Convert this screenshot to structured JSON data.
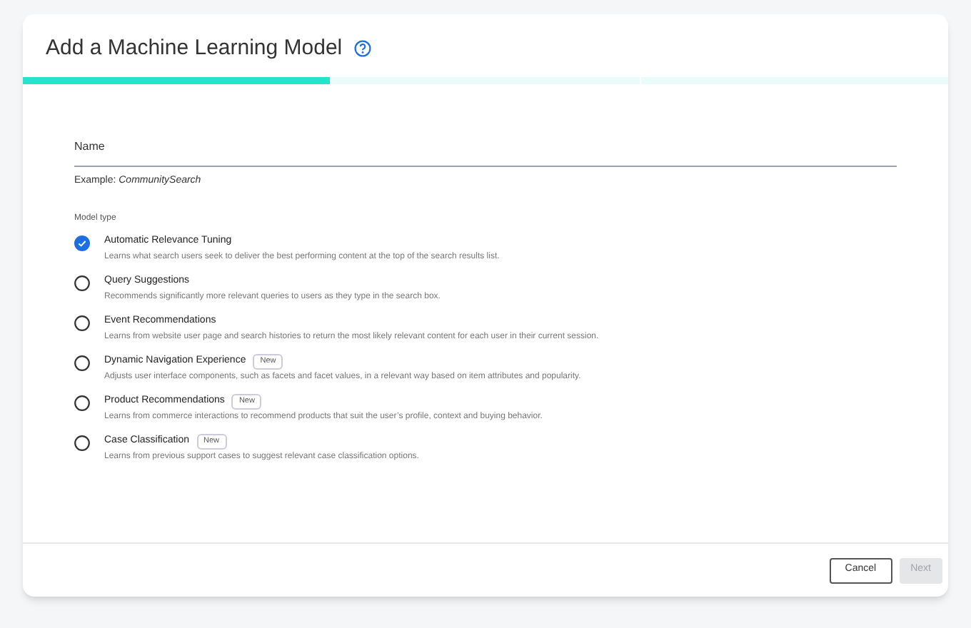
{
  "dialog": {
    "title": "Add a Machine Learning Model"
  },
  "steps": [
    {
      "done": true
    },
    {
      "done": false
    },
    {
      "done": false
    }
  ],
  "name_field": {
    "label": "Name",
    "hint": "Example: *CommunitySearch*"
  },
  "model_type": {
    "label": "Model type",
    "options": [
      {
        "title": "Automatic Relevance Tuning",
        "description": "Learns what search users seek to deliver the best performing content at the top of the search results list.",
        "selected": true
      },
      {
        "title": "Query Suggestions",
        "description": "Recommends significantly more relevant queries to users as they type in the search box.",
        "selected": false
      },
      {
        "title": "Event Recommendations",
        "description": "Learns from website user page and search histories to return the most likely relevant content for each user in their current session.",
        "selected": false
      },
      {
        "title": "Dynamic Navigation Experience",
        "badge": "New",
        "description": "Adjusts user interface components, such as facets and facet values, in a relevant way based on item attributes and popularity.",
        "selected": false
      },
      {
        "title": "Product Recommendations",
        "badge": "New",
        "description": "Learns from commerce interactions to recommend products that suit the user’s profile, context and buying behavior.",
        "selected": false
      },
      {
        "title": "Case Classification",
        "badge": "New",
        "description": "Learns from previous support cases to suggest relevant case classification options.",
        "selected": false
      }
    ]
  },
  "buttons": [
    {
      "label": "Cancel",
      "disabled": false
    },
    {
      "label": "Next",
      "disabled": true
    }
  ]
}
